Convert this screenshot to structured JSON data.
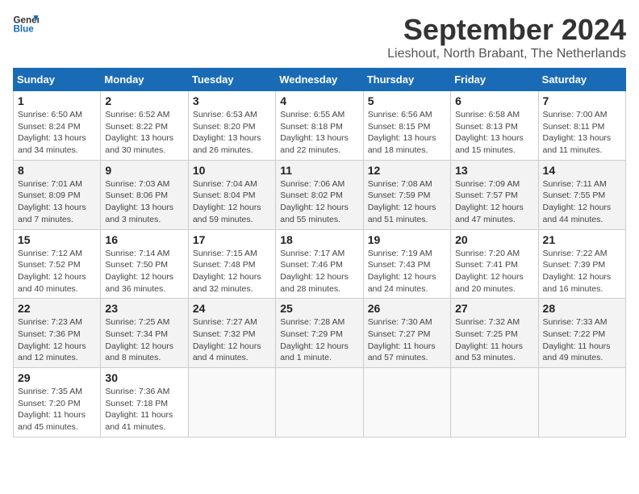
{
  "logo": {
    "line1": "General",
    "line2": "Blue"
  },
  "title": "September 2024",
  "location": "Lieshout, North Brabant, The Netherlands",
  "days_of_week": [
    "Sunday",
    "Monday",
    "Tuesday",
    "Wednesday",
    "Thursday",
    "Friday",
    "Saturday"
  ],
  "weeks": [
    [
      {
        "day": "1",
        "info": "Sunrise: 6:50 AM\nSunset: 8:24 PM\nDaylight: 13 hours\nand 34 minutes."
      },
      {
        "day": "2",
        "info": "Sunrise: 6:52 AM\nSunset: 8:22 PM\nDaylight: 13 hours\nand 30 minutes."
      },
      {
        "day": "3",
        "info": "Sunrise: 6:53 AM\nSunset: 8:20 PM\nDaylight: 13 hours\nand 26 minutes."
      },
      {
        "day": "4",
        "info": "Sunrise: 6:55 AM\nSunset: 8:18 PM\nDaylight: 13 hours\nand 22 minutes."
      },
      {
        "day": "5",
        "info": "Sunrise: 6:56 AM\nSunset: 8:15 PM\nDaylight: 13 hours\nand 18 minutes."
      },
      {
        "day": "6",
        "info": "Sunrise: 6:58 AM\nSunset: 8:13 PM\nDaylight: 13 hours\nand 15 minutes."
      },
      {
        "day": "7",
        "info": "Sunrise: 7:00 AM\nSunset: 8:11 PM\nDaylight: 13 hours\nand 11 minutes."
      }
    ],
    [
      {
        "day": "8",
        "info": "Sunrise: 7:01 AM\nSunset: 8:09 PM\nDaylight: 13 hours\nand 7 minutes."
      },
      {
        "day": "9",
        "info": "Sunrise: 7:03 AM\nSunset: 8:06 PM\nDaylight: 13 hours\nand 3 minutes."
      },
      {
        "day": "10",
        "info": "Sunrise: 7:04 AM\nSunset: 8:04 PM\nDaylight: 12 hours\nand 59 minutes."
      },
      {
        "day": "11",
        "info": "Sunrise: 7:06 AM\nSunset: 8:02 PM\nDaylight: 12 hours\nand 55 minutes."
      },
      {
        "day": "12",
        "info": "Sunrise: 7:08 AM\nSunset: 7:59 PM\nDaylight: 12 hours\nand 51 minutes."
      },
      {
        "day": "13",
        "info": "Sunrise: 7:09 AM\nSunset: 7:57 PM\nDaylight: 12 hours\nand 47 minutes."
      },
      {
        "day": "14",
        "info": "Sunrise: 7:11 AM\nSunset: 7:55 PM\nDaylight: 12 hours\nand 44 minutes."
      }
    ],
    [
      {
        "day": "15",
        "info": "Sunrise: 7:12 AM\nSunset: 7:52 PM\nDaylight: 12 hours\nand 40 minutes."
      },
      {
        "day": "16",
        "info": "Sunrise: 7:14 AM\nSunset: 7:50 PM\nDaylight: 12 hours\nand 36 minutes."
      },
      {
        "day": "17",
        "info": "Sunrise: 7:15 AM\nSunset: 7:48 PM\nDaylight: 12 hours\nand 32 minutes."
      },
      {
        "day": "18",
        "info": "Sunrise: 7:17 AM\nSunset: 7:46 PM\nDaylight: 12 hours\nand 28 minutes."
      },
      {
        "day": "19",
        "info": "Sunrise: 7:19 AM\nSunset: 7:43 PM\nDaylight: 12 hours\nand 24 minutes."
      },
      {
        "day": "20",
        "info": "Sunrise: 7:20 AM\nSunset: 7:41 PM\nDaylight: 12 hours\nand 20 minutes."
      },
      {
        "day": "21",
        "info": "Sunrise: 7:22 AM\nSunset: 7:39 PM\nDaylight: 12 hours\nand 16 minutes."
      }
    ],
    [
      {
        "day": "22",
        "info": "Sunrise: 7:23 AM\nSunset: 7:36 PM\nDaylight: 12 hours\nand 12 minutes."
      },
      {
        "day": "23",
        "info": "Sunrise: 7:25 AM\nSunset: 7:34 PM\nDaylight: 12 hours\nand 8 minutes."
      },
      {
        "day": "24",
        "info": "Sunrise: 7:27 AM\nSunset: 7:32 PM\nDaylight: 12 hours\nand 4 minutes."
      },
      {
        "day": "25",
        "info": "Sunrise: 7:28 AM\nSunset: 7:29 PM\nDaylight: 12 hours\nand 1 minute."
      },
      {
        "day": "26",
        "info": "Sunrise: 7:30 AM\nSunset: 7:27 PM\nDaylight: 11 hours\nand 57 minutes."
      },
      {
        "day": "27",
        "info": "Sunrise: 7:32 AM\nSunset: 7:25 PM\nDaylight: 11 hours\nand 53 minutes."
      },
      {
        "day": "28",
        "info": "Sunrise: 7:33 AM\nSunset: 7:22 PM\nDaylight: 11 hours\nand 49 minutes."
      }
    ],
    [
      {
        "day": "29",
        "info": "Sunrise: 7:35 AM\nSunset: 7:20 PM\nDaylight: 11 hours\nand 45 minutes."
      },
      {
        "day": "30",
        "info": "Sunrise: 7:36 AM\nSunset: 7:18 PM\nDaylight: 11 hours\nand 41 minutes."
      },
      {
        "day": "",
        "info": ""
      },
      {
        "day": "",
        "info": ""
      },
      {
        "day": "",
        "info": ""
      },
      {
        "day": "",
        "info": ""
      },
      {
        "day": "",
        "info": ""
      }
    ]
  ]
}
